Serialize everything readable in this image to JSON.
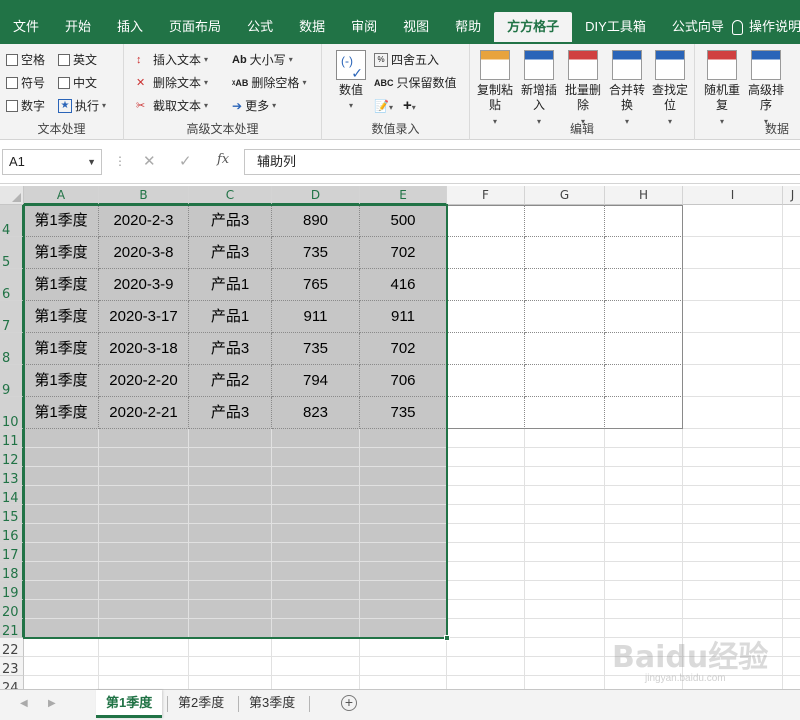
{
  "ribbon_tabs": [
    "文件",
    "开始",
    "插入",
    "页面布局",
    "公式",
    "数据",
    "审阅",
    "视图",
    "帮助",
    "方方格子",
    "DIY工具箱",
    "公式向导"
  ],
  "active_tab": "方方格子",
  "tell_me": "操作说明",
  "groups": {
    "text": {
      "label": "文本处理",
      "checkboxes": [
        "空格",
        "英文",
        "符号",
        "中文",
        "数字"
      ],
      "execute": "执行"
    },
    "advanced_text": {
      "label": "高级文本处理",
      "items": [
        "插入文本",
        "删除文本",
        "截取文本",
        "大小写",
        "删除空格",
        "更多"
      ]
    },
    "number_entry": {
      "label": "数值录入",
      "value_button": "数值",
      "items": [
        "四舍五入",
        "只保留数值"
      ]
    },
    "edit": {
      "label": "编辑",
      "buttons": [
        {
          "line1": "复制粘",
          "line2": "贴"
        },
        {
          "line1": "新增插",
          "line2": "入"
        },
        {
          "line1": "批量删",
          "line2": "除"
        },
        {
          "line1": "合并转",
          "line2": "换"
        },
        {
          "line1": "查找定",
          "line2": "位"
        }
      ]
    },
    "data": {
      "label": "数据",
      "buttons": [
        {
          "line1": "随机重",
          "line2": "复"
        },
        {
          "line1": "高级排",
          "line2": "序"
        }
      ]
    }
  },
  "formula_bar": {
    "name_box": "A1",
    "fx": "fx",
    "content": "辅助列"
  },
  "columns": [
    "A",
    "B",
    "C",
    "D",
    "E",
    "F",
    "G",
    "H",
    "I",
    "J"
  ],
  "row_numbers": [
    "4",
    "5",
    "6",
    "7",
    "8",
    "9",
    "10",
    "11",
    "12",
    "13",
    "14",
    "15",
    "16",
    "17",
    "18",
    "19",
    "20",
    "21",
    "22",
    "23",
    "24"
  ],
  "table_rows": [
    [
      "第1季度",
      "2020-2-3",
      "产品3",
      "890",
      "500"
    ],
    [
      "第1季度",
      "2020-3-8",
      "产品3",
      "735",
      "702"
    ],
    [
      "第1季度",
      "2020-3-9",
      "产品1",
      "765",
      "416"
    ],
    [
      "第1季度",
      "2020-3-17",
      "产品1",
      "911",
      "911"
    ],
    [
      "第1季度",
      "2020-3-18",
      "产品3",
      "735",
      "702"
    ],
    [
      "第1季度",
      "2020-2-20",
      "产品2",
      "794",
      "706"
    ],
    [
      "第1季度",
      "2020-2-21",
      "产品3",
      "823",
      "735"
    ]
  ],
  "sheets": [
    "第1季度",
    "第2季度",
    "第3季度"
  ],
  "active_sheet": "第1季度",
  "watermark": {
    "brand": "Baidu经验",
    "url": "jingyan.baidu.com"
  },
  "colors": {
    "accent": "#217346",
    "selection": "#c6c6c6"
  }
}
